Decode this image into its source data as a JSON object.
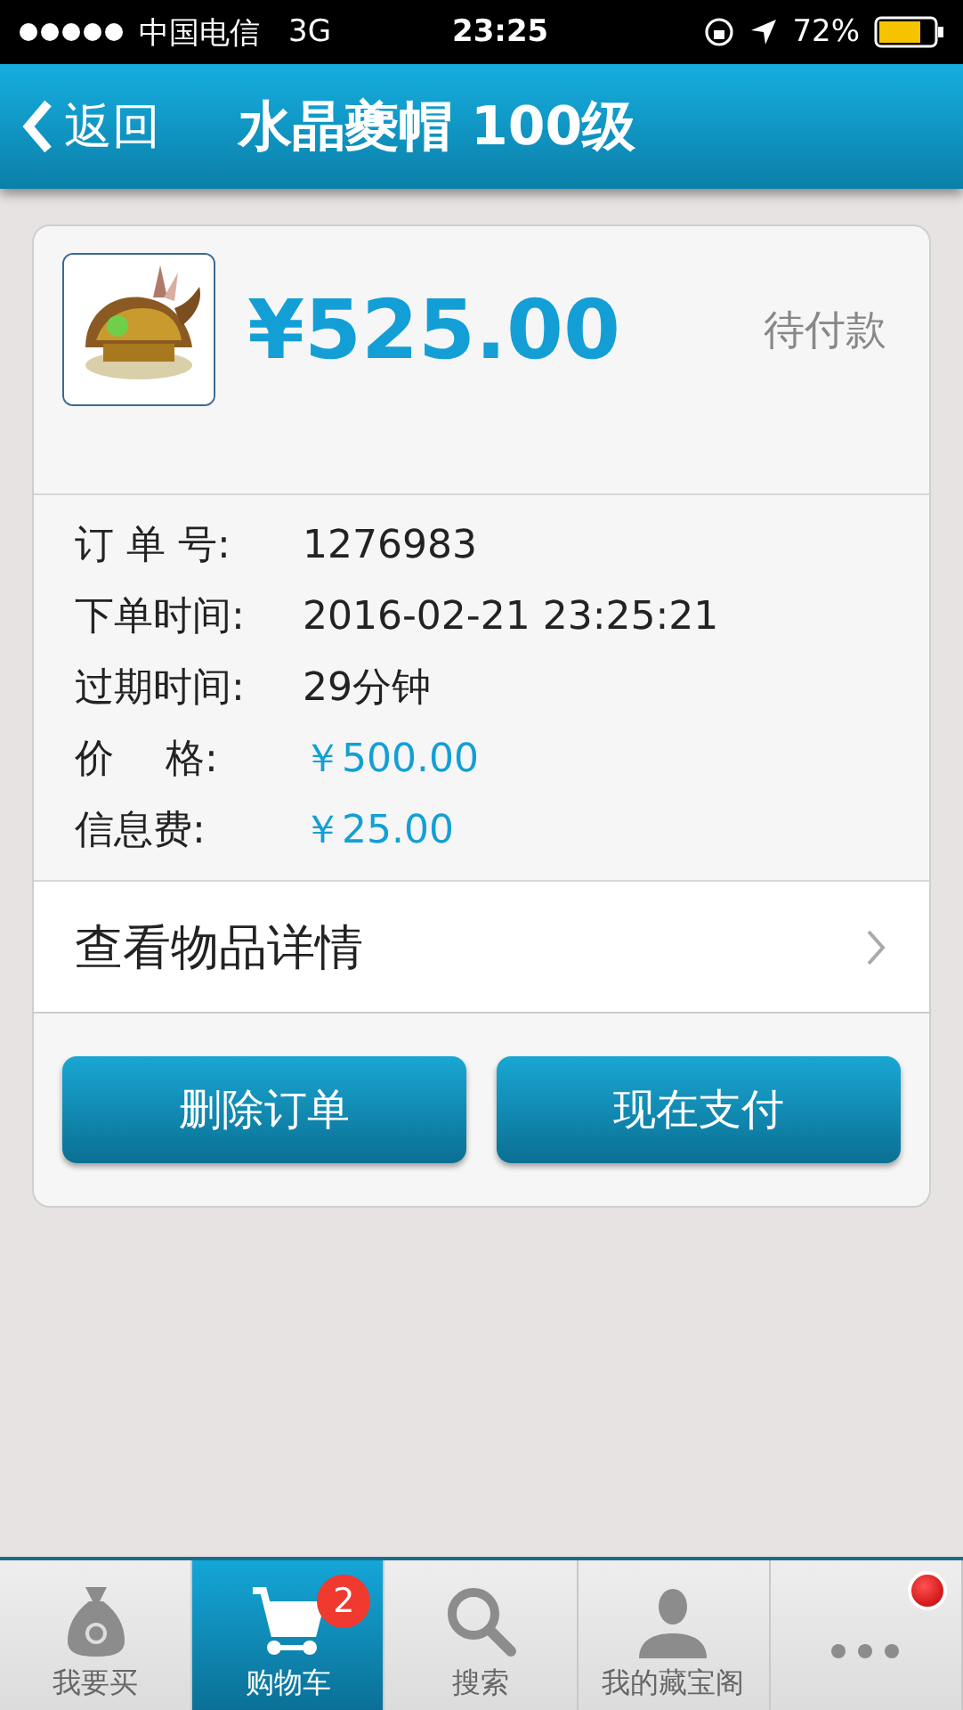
{
  "status_bar": {
    "carrier": "中国电信",
    "network": "3G",
    "time": "23:25",
    "battery": "72%"
  },
  "nav": {
    "back": "返回",
    "title": "水晶夔帽 100级"
  },
  "order": {
    "total": "¥525.00",
    "status": "待付款",
    "details": [
      {
        "label": "订 单 号:",
        "value": "1276983",
        "kind": "plain"
      },
      {
        "label": "下单时间:",
        "value": "2016-02-21 23:25:21",
        "kind": "plain"
      },
      {
        "label": "过期时间:",
        "value": "29分钟",
        "kind": "plain"
      },
      {
        "label": "价　 格:",
        "value": "￥500.00",
        "kind": "price"
      },
      {
        "label": "信息费:",
        "value": "￥25.00",
        "kind": "price"
      }
    ],
    "detail_link": "查看物品详情",
    "buttons": [
      "删除订单",
      "现在支付"
    ]
  },
  "tabs": [
    {
      "label": "我要买",
      "selected": false
    },
    {
      "label": "购物车",
      "selected": true,
      "badge": "2"
    },
    {
      "label": "搜索",
      "selected": false
    },
    {
      "label": "我的藏宝阁",
      "selected": false
    },
    {
      "selected": false,
      "alert": true
    }
  ]
}
